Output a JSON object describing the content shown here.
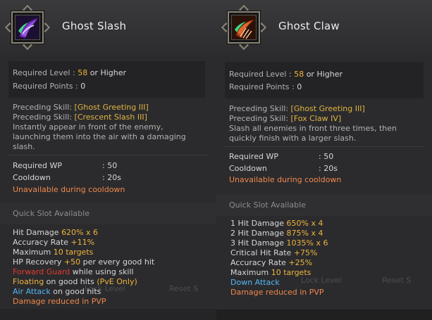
{
  "left": {
    "title": "Ghost Slash",
    "icon": "ghost-slash-skill-icon",
    "required_level_label": "Required Level : ",
    "required_level_value": "58",
    "required_level_suffix": " or Higher",
    "required_points_label": "Required Points : ",
    "required_points_value": "0",
    "preceding_1_label": "Preceding Skill: ",
    "preceding_1_value": "[Ghost Greeting III]",
    "preceding_2_label": "Preceding Skill: ",
    "preceding_2_value": "[Crescent Slash III]",
    "description_line1": "Instantly appear in front of the enemy,",
    "description_line2": "launching them into the air with a damaging",
    "description_line3": "slash.",
    "wp_label": "Required WP",
    "wp_value": ": 50",
    "cooldown_label": "Cooldown",
    "cooldown_value": ": 20s",
    "cooldown_note": "Unavailable during cooldown",
    "quick_slot": "Quick Slot Available",
    "effects": {
      "hit_damage_label": "Hit Damage ",
      "hit_damage_value": "620% x 6",
      "accuracy_label": "Accuracy Rate ",
      "accuracy_value": "+11%",
      "maximum_label": "Maximum ",
      "maximum_value": "10 targets",
      "hp_label": "HP Recovery ",
      "hp_value": "+50",
      "hp_suffix": " per every good hit",
      "forward_guard": "Forward Guard",
      "forward_guard_suffix": " while using skill",
      "floating": "Floating",
      "floating_suffix": " on good hits ",
      "floating_pve": "(PvE Only)",
      "air_attack": "Air Attack",
      "air_attack_suffix": " on good hits",
      "pvp_note": "Damage reduced in PVP"
    },
    "ghost_text_1": "Lock Level",
    "ghost_text_2": "Reset S"
  },
  "right": {
    "title": "Ghost Claw",
    "icon": "ghost-claw-skill-icon",
    "required_level_label": "Required Level : ",
    "required_level_value": "58",
    "required_level_suffix": " or Higher",
    "required_points_label": "Required Points : ",
    "required_points_value": "0",
    "preceding_1_label": "Preceding Skill: ",
    "preceding_1_value": "[Ghost Greeting III]",
    "preceding_2_label": "Preceding Skill: ",
    "preceding_2_value": "[Fox Claw IV]",
    "description_line1": "Slash all enemies in front three times, then",
    "description_line2": "quickly finish with a larger slash.",
    "wp_label": "Required WP",
    "wp_value": ": 50",
    "cooldown_label": "Cooldown",
    "cooldown_value": ": 20s",
    "cooldown_note": "Unavailable during cooldown",
    "quick_slot": "Quick Slot Available",
    "effects": {
      "hit1_label": "1 Hit Damage ",
      "hit1_value": "650% x 4",
      "hit2_label": "2 Hit Damage ",
      "hit2_value": "875% x 4",
      "hit3_label": "3 Hit Damage ",
      "hit3_value": "1035% x 6",
      "crit_label": "Critical Hit Rate ",
      "crit_value": "+75%",
      "accuracy_label": "Accuracy Rate ",
      "accuracy_value": "+25%",
      "maximum_label": "Maximum ",
      "maximum_value": "10 targets",
      "down_attack": "Down Attack",
      "pvp_note": "Damage reduced in PVP"
    },
    "ghost_text_1": "Lock Level",
    "ghost_text_2": "Reset S"
  },
  "colors": {
    "value": "#efb43a",
    "link": "#e0b440",
    "warning": "#f0884a",
    "forward_guard": "#e33a2c",
    "air_down_attack": "#55b8f2"
  }
}
